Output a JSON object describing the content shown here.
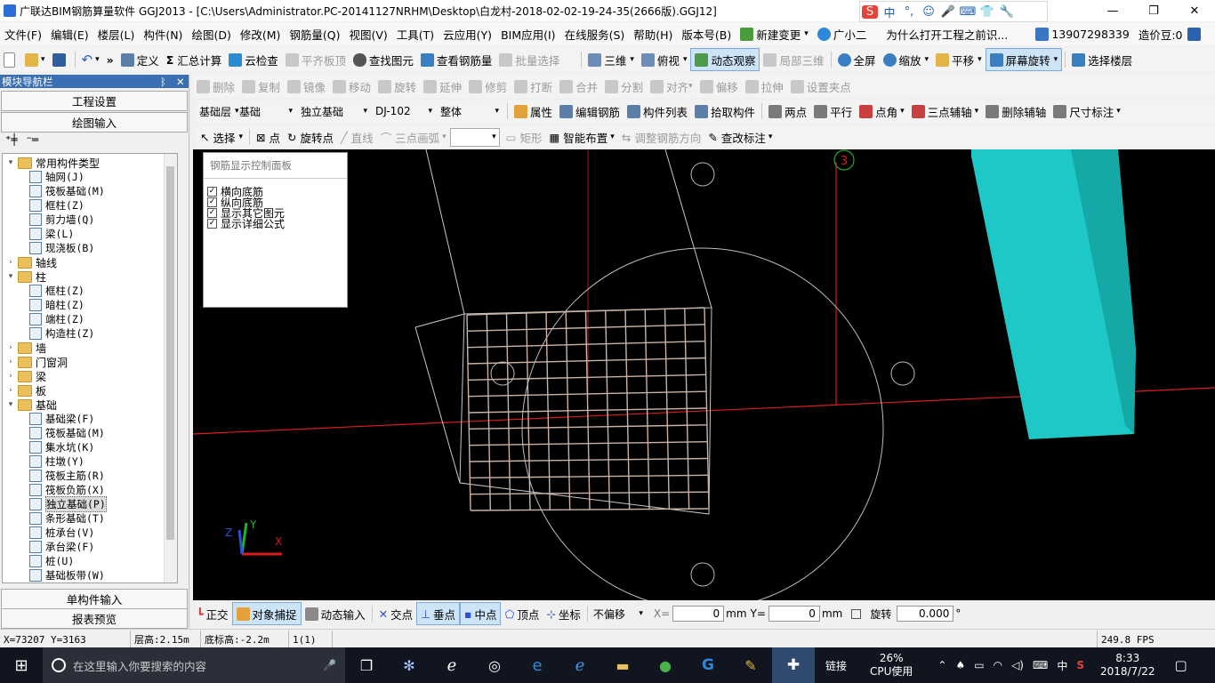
{
  "window": {
    "title": "广联达BIM钢筋算量软件 GGJ2013 - [C:\\Users\\Administrator.PC-20141127NRHM\\Desktop\\白龙村-2018-02-02-19-24-35(2666版).GGJ12]",
    "minimize": "—",
    "maximize": "❐",
    "close": "✕"
  },
  "ime": {
    "logo": "S",
    "mode": "中",
    "items": [
      "°,",
      "☺",
      "🎤",
      "⌨",
      "👕",
      "🔧"
    ]
  },
  "menubar": {
    "items": [
      "文件(F)",
      "编辑(E)",
      "楼层(L)",
      "构件(N)",
      "绘图(D)",
      "修改(M)",
      "钢筋量(Q)",
      "视图(V)",
      "工具(T)",
      "云应用(Y)",
      "BIM应用(I)",
      "在线服务(S)",
      "帮助(H)",
      "版本号(B)"
    ],
    "new_change": "新建变更",
    "guangxiaoer": "广小二",
    "question": "为什么打开工程之前识...",
    "phone": "13907298339",
    "price_bean": "造价豆:0"
  },
  "toolbar1": {
    "items": [
      "定义",
      "汇总计算",
      "云检查",
      "平齐板顶",
      "查找图元",
      "查看钢筋量",
      "批量选择"
    ],
    "view3d": "三维",
    "topview": "俯视",
    "dynamic": "动态观察",
    "local3d": "局部三维",
    "fullscreen": "全屏",
    "zoom": "缩放",
    "pan": "平移",
    "rotate": "屏幕旋转",
    "select_floor": "选择楼层"
  },
  "toolbar2": {
    "items": [
      "删除",
      "复制",
      "镜像",
      "移动",
      "旋转",
      "延伸",
      "修剪",
      "打断",
      "合并",
      "分割",
      "对齐",
      "偏移",
      "拉伸",
      "设置夹点"
    ]
  },
  "toolbar3": {
    "layer": "基础层",
    "category": "基础",
    "type": "独立基础",
    "name": "DJ-102",
    "whole": "整体",
    "items": [
      "属性",
      "编辑钢筋",
      "构件列表",
      "拾取构件",
      "两点",
      "平行",
      "点角",
      "三点辅轴",
      "删除辅轴",
      "尺寸标注"
    ]
  },
  "toolbar4": {
    "select": "选择",
    "point": "点",
    "rotate_point": "旋转点",
    "line": "直线",
    "arc": "三点画弧",
    "arc_value": "",
    "rect": "矩形",
    "smart": "智能布置",
    "adjust": "调整钢筋方向",
    "modify_label": "查改标注"
  },
  "leftpanel": {
    "title": "模块导航栏",
    "pin": "ᛒ",
    "close": "✕",
    "tab1": "工程设置",
    "tab2": "绘图输入",
    "bottom1": "单构件输入",
    "bottom2": "报表预览",
    "tree": [
      {
        "level": 0,
        "expand": "▾",
        "type": "folder",
        "label": "常用构件类型"
      },
      {
        "level": 1,
        "type": "leaf",
        "label": "轴网(J)"
      },
      {
        "level": 1,
        "type": "leaf",
        "label": "筏板基础(M)"
      },
      {
        "level": 1,
        "type": "leaf",
        "label": "框柱(Z)"
      },
      {
        "level": 1,
        "type": "leaf",
        "label": "剪力墙(Q)"
      },
      {
        "level": 1,
        "type": "leaf",
        "label": "梁(L)"
      },
      {
        "level": 1,
        "type": "leaf",
        "label": "现浇板(B)"
      },
      {
        "level": 0,
        "expand": "›",
        "type": "folder",
        "label": "轴线"
      },
      {
        "level": 0,
        "expand": "▾",
        "type": "folder",
        "label": "柱"
      },
      {
        "level": 1,
        "type": "leaf",
        "label": "框柱(Z)"
      },
      {
        "level": 1,
        "type": "leaf",
        "label": "暗柱(Z)"
      },
      {
        "level": 1,
        "type": "leaf",
        "label": "端柱(Z)"
      },
      {
        "level": 1,
        "type": "leaf",
        "label": "构造柱(Z)"
      },
      {
        "level": 0,
        "expand": "›",
        "type": "folder",
        "label": "墙"
      },
      {
        "level": 0,
        "expand": "›",
        "type": "folder",
        "label": "门窗洞"
      },
      {
        "level": 0,
        "expand": "›",
        "type": "folder",
        "label": "梁"
      },
      {
        "level": 0,
        "expand": "›",
        "type": "folder",
        "label": "板"
      },
      {
        "level": 0,
        "expand": "▾",
        "type": "folder",
        "label": "基础"
      },
      {
        "level": 1,
        "type": "leaf",
        "label": "基础梁(F)"
      },
      {
        "level": 1,
        "type": "leaf",
        "label": "筏板基础(M)"
      },
      {
        "level": 1,
        "type": "leaf",
        "label": "集水坑(K)"
      },
      {
        "level": 1,
        "type": "leaf",
        "label": "柱墩(Y)"
      },
      {
        "level": 1,
        "type": "leaf",
        "label": "筏板主筋(R)"
      },
      {
        "level": 1,
        "type": "leaf",
        "label": "筏板负筋(X)"
      },
      {
        "level": 1,
        "type": "leaf",
        "label": "独立基础(P)",
        "selected": true
      },
      {
        "level": 1,
        "type": "leaf",
        "label": "条形基础(T)"
      },
      {
        "level": 1,
        "type": "leaf",
        "label": "桩承台(V)"
      },
      {
        "level": 1,
        "type": "leaf",
        "label": "承台梁(F)"
      },
      {
        "level": 1,
        "type": "leaf",
        "label": "桩(U)"
      },
      {
        "level": 1,
        "type": "leaf",
        "label": "基础板带(W)"
      }
    ]
  },
  "control_panel": {
    "title": "钢筋显示控制面板",
    "options": [
      "横向底筋",
      "纵向底筋",
      "显示其它图元",
      "显示详细公式"
    ]
  },
  "viewport": {
    "axis_label": "3",
    "axis_x": "X",
    "axis_y": "Y",
    "axis_z": "Z"
  },
  "snapbar": {
    "ortho": "正交",
    "snap": "对象捕捉",
    "dyn_input": "动态输入",
    "intersection": "交点",
    "perpendicular": "垂点",
    "midpoint": "中点",
    "vertex": "顶点",
    "coordinate": "坐标",
    "offset_mode": "不偏移",
    "x_label": "X=",
    "x_value": "0",
    "y_label": "Y=",
    "y_value": "0",
    "unit": "mm",
    "rotate": "旋转",
    "rotate_value": "0.000",
    "degree": "°"
  },
  "status": {
    "coords": "X=73207 Y=3163",
    "floor_height": "层高:2.15m",
    "bottom_height": "底标高:-2.2m",
    "count": "1(1)",
    "fps": "249.8 FPS"
  },
  "taskbar": {
    "search_placeholder": "在这里输入你要搜索的内容",
    "link": "链接",
    "cpu_percent": "26%",
    "cpu_label": "CPU使用",
    "lang": "中",
    "time": "8:33",
    "date": "2018/7/22"
  }
}
